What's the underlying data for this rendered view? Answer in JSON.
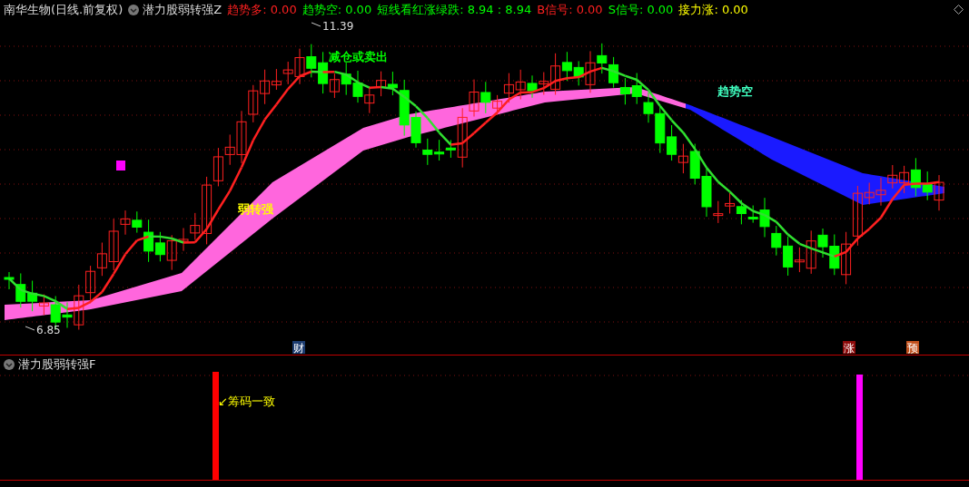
{
  "header": {
    "stock_title": "南华生物(日线.前复权)",
    "indicator_name": "潜力股弱转强Z",
    "indicators": [
      {
        "label": "趋势多:",
        "value": "0.00",
        "color": "#ff2020"
      },
      {
        "label": "趋势空:",
        "value": "0.00",
        "color": "#00ff00"
      },
      {
        "label": "短线看红涨绿跌:",
        "value": "8.94 : 8.94",
        "color": "#00ff00"
      },
      {
        "label": "B信号:",
        "value": "0.00",
        "color": "#ff2020"
      },
      {
        "label": "S信号:",
        "value": "0.00",
        "color": "#00ff00"
      },
      {
        "label": "接力涨:",
        "value": "0.00",
        "color": "#ffff00"
      }
    ]
  },
  "chart_labels": [
    {
      "kind": "high",
      "text": "11.39"
    },
    {
      "kind": "low",
      "text": "6.85"
    },
    {
      "kind": "signal",
      "text": "减仓或卖出",
      "color": "#00ff00"
    },
    {
      "kind": "signal",
      "text": "趋势空",
      "color": "#40ffc0"
    },
    {
      "kind": "signal",
      "text": "弱转强",
      "color": "#ffff00"
    }
  ],
  "event_markers": [
    {
      "label": "财",
      "color": "#1c3c70"
    },
    {
      "label": "涨",
      "color": "#8c0a0a"
    },
    {
      "label": "预",
      "color": "#c0501c"
    }
  ],
  "lower_panel": {
    "title": "潜力股弱转强F",
    "annotation": "↙筹码一致",
    "signal_bars": [
      {
        "color": "#ff0000"
      },
      {
        "color": "#ff00ff"
      }
    ]
  }
}
